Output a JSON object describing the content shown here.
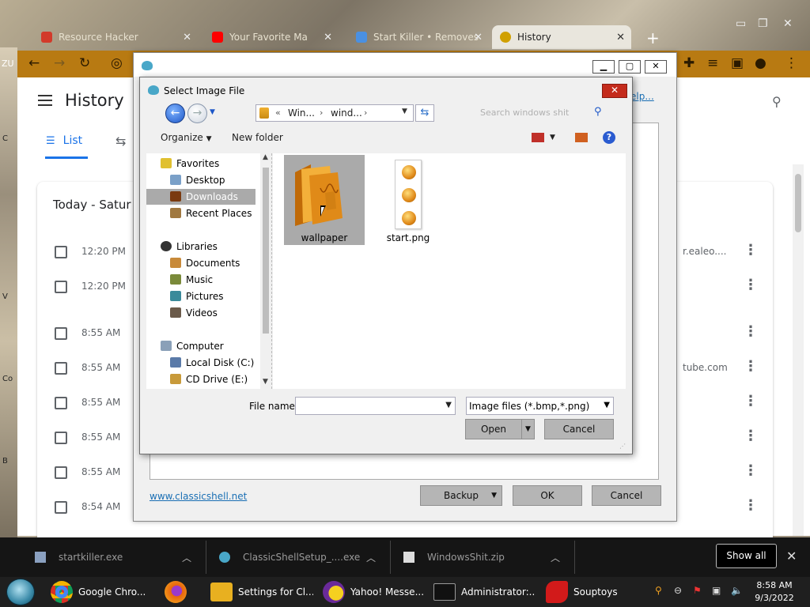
{
  "browser": {
    "tabs": [
      {
        "title": "Resource Hacker",
        "icon_color": "#d23a2a"
      },
      {
        "title": "Your Favorite Ma",
        "icon_color": "#ff0000"
      },
      {
        "title": "Start Killer • Removes",
        "icon_color": "#4a90e2"
      },
      {
        "title": "History",
        "icon_color": "#d0a000"
      }
    ],
    "new_tab_label": "+",
    "zu_label": "ZU"
  },
  "history": {
    "title": "History",
    "tab_list_label": "List",
    "card_title": "Today - Satur",
    "rows": [
      {
        "time": "12:20 PM",
        "domain": "r.ealeo...."
      },
      {
        "time": "12:20 PM",
        "domain": ""
      },
      {
        "time": "8:55 AM",
        "domain": ""
      },
      {
        "time": "8:55 AM",
        "domain": "tube.com"
      },
      {
        "time": "8:55 AM",
        "domain": ""
      },
      {
        "time": "8:55 AM",
        "domain": ""
      },
      {
        "time": "8:55 AM",
        "domain": ""
      },
      {
        "time": "8:54 AM",
        "domain": ""
      }
    ]
  },
  "settings_window": {
    "help_link": "elp...",
    "link": "www.classicshell.net",
    "backup_label": "Backup",
    "ok_label": "OK",
    "cancel_label": "Cancel"
  },
  "dialog": {
    "title": "Select Image File",
    "close_label": "✕",
    "breadcrumb": [
      "Win...",
      "wind..."
    ],
    "breadcrumb_prefix": "«",
    "search_placeholder": "Search windows shit",
    "organize_label": "Organize",
    "new_folder_label": "New folder",
    "nav_items": [
      {
        "label": "Favorites",
        "icon_color": "#e0c030",
        "level": 0
      },
      {
        "label": "Desktop",
        "icon_color": "#7aa0c8",
        "level": 1
      },
      {
        "label": "Downloads",
        "icon_color": "#7a3a10",
        "level": 1,
        "selected": true
      },
      {
        "label": "Recent Places",
        "icon_color": "#a07840",
        "level": 1
      },
      {
        "label": "Libraries",
        "icon_color": "#333333",
        "level": 0
      },
      {
        "label": "Documents",
        "icon_color": "#c88a3a",
        "level": 1
      },
      {
        "label": "Music",
        "icon_color": "#7a8a3a",
        "level": 1
      },
      {
        "label": "Pictures",
        "icon_color": "#3a8a9a",
        "level": 1
      },
      {
        "label": "Videos",
        "icon_color": "#6a5a4a",
        "level": 1
      },
      {
        "label": "Computer",
        "icon_color": "#8aa0b8",
        "level": 0
      },
      {
        "label": "Local Disk (C:)",
        "icon_color": "#5a7aa8",
        "level": 1
      },
      {
        "label": "CD Drive (E:)",
        "icon_color": "#c89a3a",
        "level": 1
      }
    ],
    "files": [
      {
        "name": "wallpaper",
        "type": "folder",
        "selected": true
      },
      {
        "name": "start.png",
        "type": "image",
        "selected": false
      }
    ],
    "file_name_label": "File name:",
    "file_name_value": "",
    "filter_value": "Image files (*.bmp,*.png)",
    "open_label": "Open",
    "cancel_label": "Cancel"
  },
  "switcher": {
    "items": [
      {
        "label": "startkiller.exe"
      },
      {
        "label": "ClassicShellSetup_....exe"
      },
      {
        "label": "WindowsShit.zip"
      }
    ],
    "show_all_label": "Show all"
  },
  "taskbar": {
    "items": [
      {
        "label": "Google Chro...",
        "icon_color": "#d93025"
      },
      {
        "label": "",
        "icon_color": "#e8650f"
      },
      {
        "label": "Settings for Cl...",
        "icon_color": "#e8b020"
      },
      {
        "label": "Yahoo! Messe...",
        "icon_color": "#6a2a9a"
      },
      {
        "label": "Administrator:...",
        "icon_color": "#111111"
      },
      {
        "label": "Souptoys",
        "icon_color": "#d21a1a"
      }
    ],
    "clock_time": "8:58 AM",
    "clock_date": "9/3/2022"
  }
}
